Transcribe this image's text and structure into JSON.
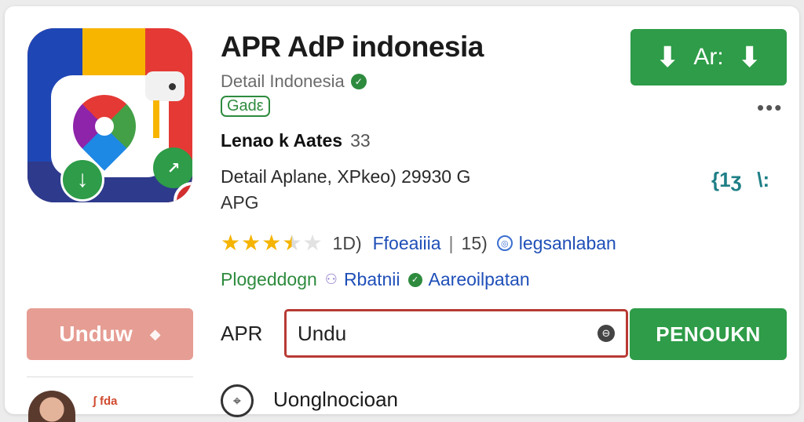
{
  "app": {
    "title": "APR AdP indonesia",
    "developer": "Detail Indonesia",
    "chip": "Gadε",
    "rating_label": "Lenao k Aates",
    "rating_count": "33",
    "details_line": "Detail Aplane, XPkeo) 29930 G",
    "details_line2": "APG",
    "stars_value": 3.5,
    "stars_num": "1D)",
    "review_link": "Ffoeaiiia",
    "separator": "|",
    "count2": "15)",
    "tag_link": "legsanlaban",
    "category": "Plogeddogn",
    "category_link": "Rbatnii",
    "category_link2": "Aareoilpatan"
  },
  "actions": {
    "install_label": "Ar:",
    "more": "•••",
    "side_icon1": "{1ʒ",
    "side_icon2": "\\:",
    "unduw_label": "Unduw",
    "apr_label": "APR",
    "search_value": "Undu",
    "penounn_label": "PENOUKN"
  },
  "bottom": {
    "badge": "ʃ",
    "badge_text": "fda",
    "title": "Uonglnocioan"
  },
  "colors": {
    "green": "#2e9c48",
    "salmon": "#e69d93",
    "border_red": "#b83a34",
    "link_blue": "#1f4fb8",
    "star": "#f5b400"
  }
}
